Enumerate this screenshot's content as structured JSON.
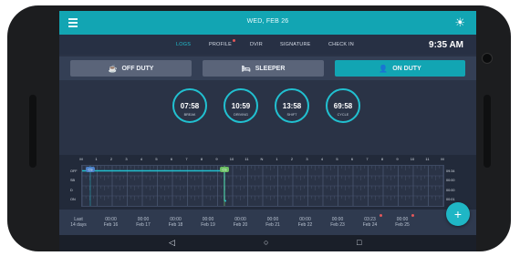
{
  "appbar": {
    "title": "WED, FEB 26",
    "menu_icon": "hamburger-icon",
    "theme_icon": "sun-icon"
  },
  "tabs": [
    {
      "label": "LOGS",
      "active": true,
      "badge": false
    },
    {
      "label": "PROFILE",
      "active": false,
      "badge": true
    },
    {
      "label": "DVIR",
      "active": false,
      "badge": false
    },
    {
      "label": "SIGNATURE",
      "active": false,
      "badge": false
    },
    {
      "label": "CHECK IN",
      "active": false,
      "badge": false
    }
  ],
  "clock": "9:35 AM",
  "status_buttons": [
    {
      "label": "OFF DUTY",
      "icon": "coffee-icon",
      "active": false
    },
    {
      "label": "SLEEPER",
      "icon": "bed-icon",
      "active": false
    },
    {
      "label": "ON DUTY",
      "icon": "user-gear-icon",
      "active": true
    }
  ],
  "timers": [
    {
      "value": "07:58",
      "label": "BREAK"
    },
    {
      "value": "10:59",
      "label": "DRIVING"
    },
    {
      "value": "13:58",
      "label": "SHIFT"
    },
    {
      "value": "69:58",
      "label": "CYCLE"
    }
  ],
  "graph": {
    "hours": [
      "M",
      "1",
      "2",
      "3",
      "4",
      "5",
      "6",
      "7",
      "8",
      "9",
      "10",
      "11",
      "N",
      "1",
      "2",
      "3",
      "4",
      "5",
      "6",
      "7",
      "8",
      "9",
      "10",
      "11",
      "M"
    ],
    "rows": [
      {
        "label": "OFF",
        "total": "09:34"
      },
      {
        "label": "SB",
        "total": "00:00"
      },
      {
        "label": "D",
        "total": "00:00"
      },
      {
        "label": "ON",
        "total": "00:01"
      }
    ],
    "markers": [
      "CS",
      "CS"
    ]
  },
  "dates": [
    {
      "top": "Last",
      "bottom": "14 days",
      "dot": false
    },
    {
      "top": "00:00",
      "bottom": "Feb 16",
      "dot": false
    },
    {
      "top": "00:00",
      "bottom": "Feb 17",
      "dot": false
    },
    {
      "top": "00:00",
      "bottom": "Feb 18",
      "dot": false
    },
    {
      "top": "00:00",
      "bottom": "Feb 19",
      "dot": false
    },
    {
      "top": "00:00",
      "bottom": "Feb 20",
      "dot": false
    },
    {
      "top": "00:00",
      "bottom": "Feb 21",
      "dot": false
    },
    {
      "top": "00:00",
      "bottom": "Feb 22",
      "dot": false
    },
    {
      "top": "00:00",
      "bottom": "Feb 23",
      "dot": false
    },
    {
      "top": "03:23",
      "bottom": "Feb 24",
      "dot": true
    },
    {
      "top": "00:00",
      "bottom": "Feb 25",
      "dot": true
    }
  ],
  "fab": {
    "label": "+"
  },
  "navbar": {
    "back": "◁",
    "home": "○",
    "recent": "□"
  },
  "colors": {
    "accent": "#21c0d0",
    "background": "#2a3346",
    "appbar": "#12a5b3"
  }
}
